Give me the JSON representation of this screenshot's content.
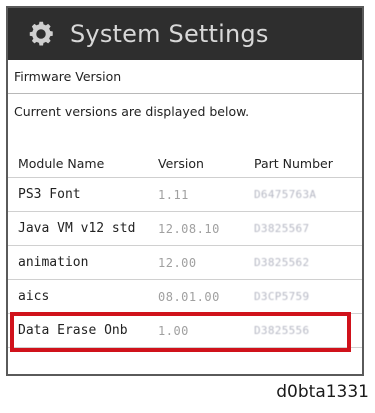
{
  "window": {
    "title": "System Settings",
    "icon": "gear-icon"
  },
  "section": {
    "title": "Firmware Version",
    "description": "Current versions are displayed below."
  },
  "table": {
    "columns": [
      "Module Name",
      "Version",
      "Part Number"
    ],
    "rows": [
      {
        "module": "PS3 Font",
        "version": "1.11",
        "part": "D6475763A"
      },
      {
        "module": "Java VM v12 std",
        "version": "12.08.10",
        "part": "D3825567"
      },
      {
        "module": "animation",
        "version": "12.00",
        "part": "D3825562"
      },
      {
        "module": "aics",
        "version": "08.01.00",
        "part": "D3CP5759"
      },
      {
        "module": "Data Erase Onb",
        "version": "1.00",
        "part": "D3825556"
      }
    ],
    "highlighted_row": "aics"
  },
  "caption": "d0bta1331",
  "colors": {
    "titlebar": "#2e2e2e",
    "highlight": "#d0121b"
  }
}
